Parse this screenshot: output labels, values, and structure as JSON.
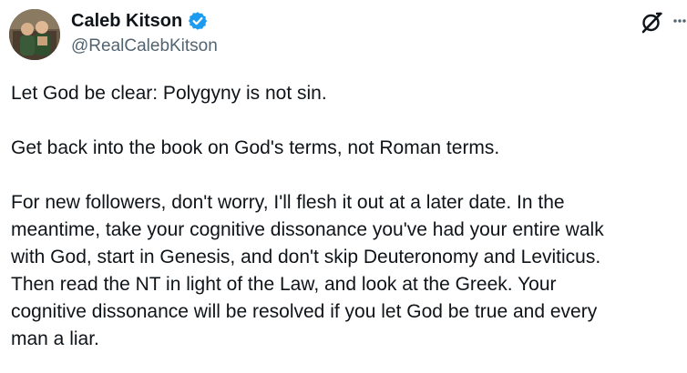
{
  "author": {
    "display_name": "Caleb Kitson",
    "handle": "@RealCalebKitson",
    "verified_color": "#1d9bf0"
  },
  "header_actions": {
    "grok_icon": "grok-icon",
    "more_icon": "more-options-icon"
  },
  "tweet": {
    "paragraphs": [
      "Let God be clear: Polygyny is not sin.",
      "Get back into the book on God's terms, not Roman terms.",
      "For new followers, don't worry, I'll flesh it out at a later date.  In the\nmeantime, take your cognitive dissonance you've had your entire walk\nwith God, start in Genesis, and don't skip Deuteronomy and Leviticus.\nThen read the NT in light of the Law, and look at the Greek. Your\ncognitive dissonance will be resolved if you let God be true and every\nman a liar."
    ]
  }
}
